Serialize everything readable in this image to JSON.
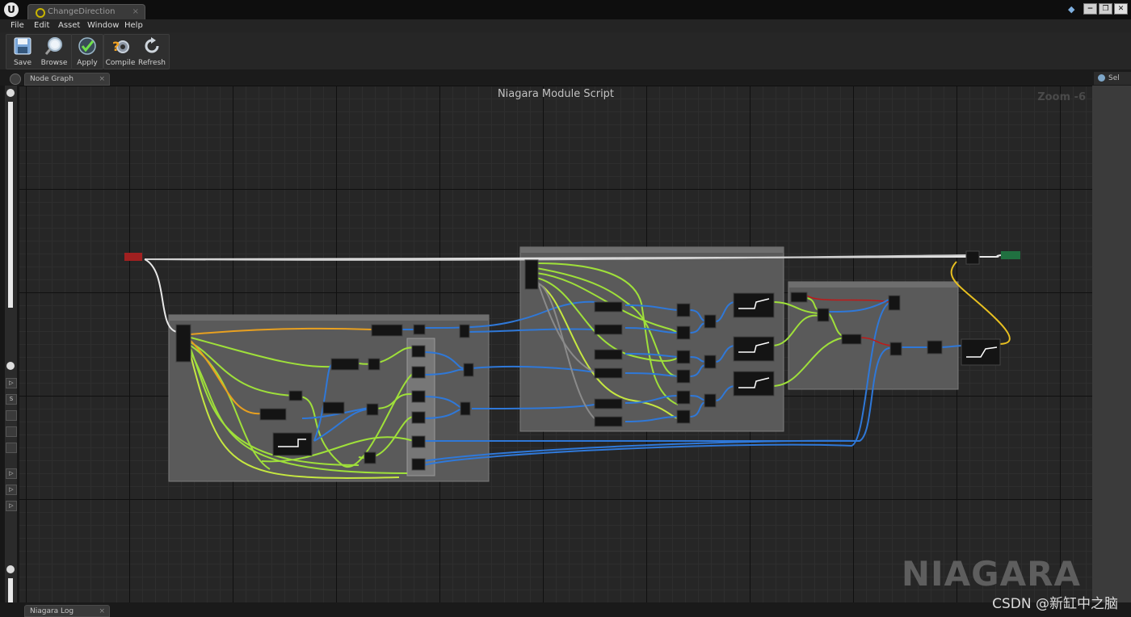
{
  "window": {
    "tab_title": "ChangeDirection",
    "tab_close": "×",
    "logo": "U",
    "controls": [
      "−",
      "❐",
      "✕"
    ]
  },
  "menu": [
    "File",
    "Edit",
    "Asset",
    "Window",
    "Help"
  ],
  "toolbar": {
    "buttons": [
      {
        "label": "Save",
        "icon": "save-icon"
      },
      {
        "label": "Browse",
        "icon": "browse-icon"
      },
      {
        "label": "Apply",
        "icon": "apply-icon"
      },
      {
        "label": "Compile",
        "icon": "compile-icon"
      },
      {
        "label": "Refresh",
        "icon": "refresh-icon"
      }
    ]
  },
  "tabs": {
    "graph": "Node Graph",
    "graph_close": "×",
    "details": "Sel",
    "log": "Niagara Log",
    "log_close": "×"
  },
  "canvas": {
    "title": "Niagara Module Script",
    "zoom": "Zoom -6",
    "watermark": "NIAGARA"
  },
  "overlay": {
    "csdn": "CSDN @新缸中之脑"
  },
  "colors": {
    "wire_exec": "#e8e8e8",
    "wire_float": "#9fe03a",
    "wire_vector": "#2f78d8",
    "wire_bool": "#c01818",
    "wire_orange": "#e8a020",
    "wire_grey": "#8a8a8a",
    "node_header": "#2c3e55",
    "input_node": "#a02020",
    "output_node": "#207040",
    "comment_fill": "#5a5a5a"
  }
}
